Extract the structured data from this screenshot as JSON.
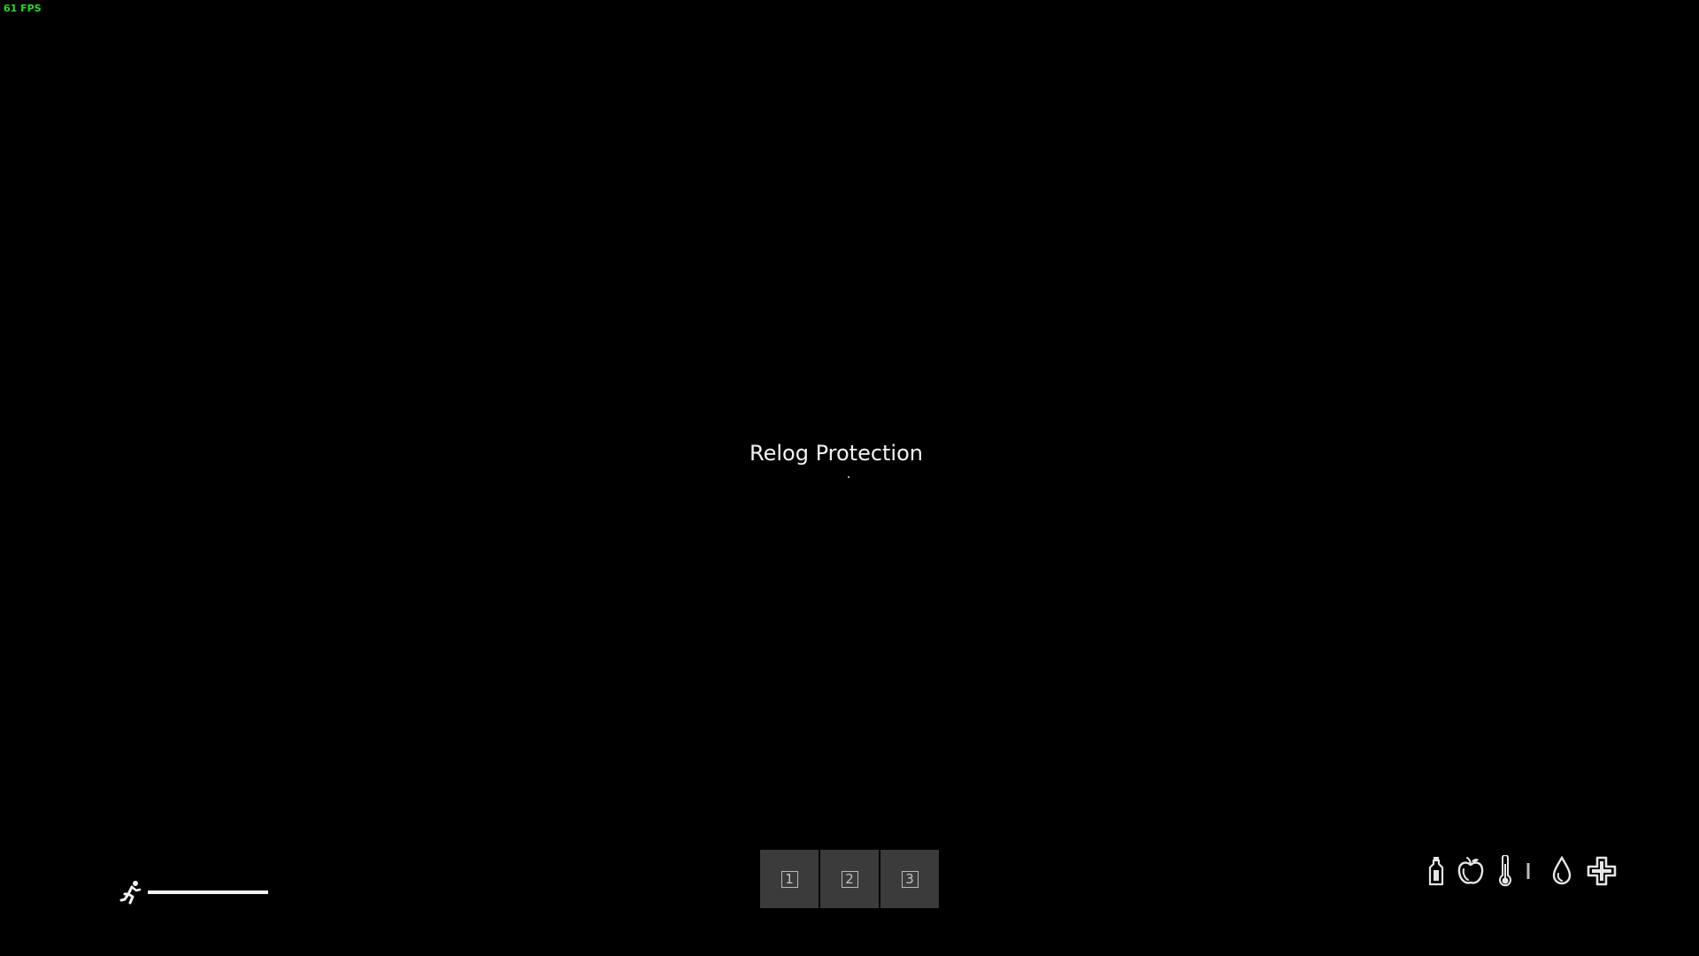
{
  "hud": {
    "fps_text": "61 FPS",
    "center_message": "Relog Protection"
  },
  "stamina": {
    "icon": "running-person-icon",
    "level": 1.0,
    "color": "#f4f4f4"
  },
  "hotbar": {
    "slots": [
      {
        "key": "1"
      },
      {
        "key": "2"
      },
      {
        "key": "3"
      }
    ]
  },
  "status_icons": [
    "moon-icon",
    "bottle-icon",
    "apple-icon",
    "thermometer-icon",
    "blood-drop-icon",
    "health-cross-icon"
  ],
  "colors": {
    "background": "#000000",
    "fps": "#22dd22",
    "slot": "#3b3b3b",
    "icons": "#e6e6e6"
  }
}
